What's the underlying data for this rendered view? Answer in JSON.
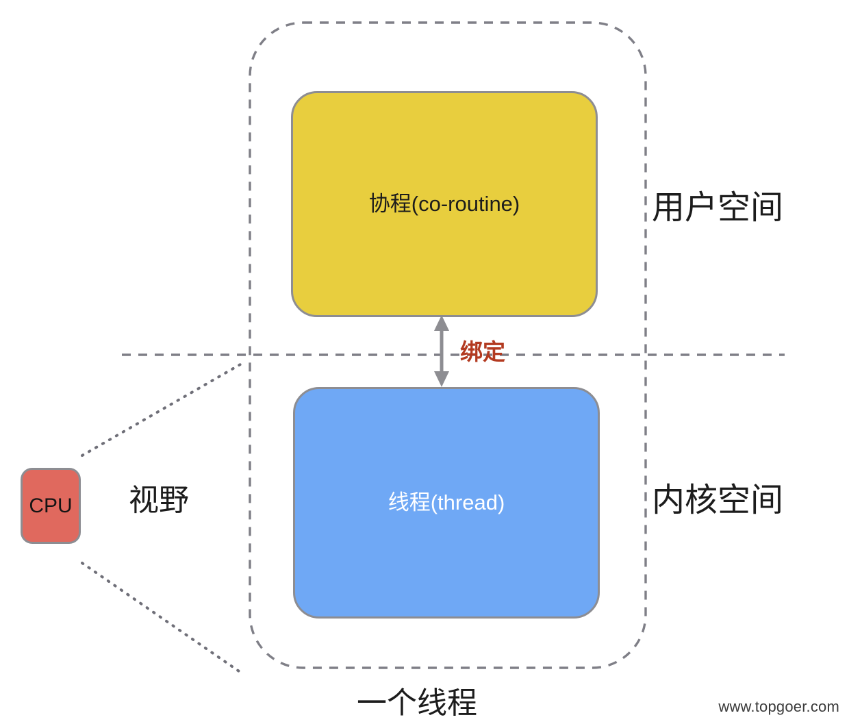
{
  "diagram": {
    "title_bottom": "一个线程",
    "watermark": "www.topgoer.com",
    "colors": {
      "coroutine_fill": "#e8ce3e",
      "thread_fill": "#6fa8f5",
      "cpu_fill": "#e0695e",
      "stroke_gray": "#8d8d92",
      "binding_red": "#b33a20",
      "dash_gray": "#7f7f87"
    },
    "blocks": [
      {
        "id": "coroutine",
        "label": "协程(co-routine)"
      },
      {
        "id": "thread",
        "label": "线程(thread)"
      },
      {
        "id": "cpu",
        "label": "CPU"
      }
    ],
    "regions": {
      "user_space": "用户空间",
      "kernel_space": "内核空间"
    },
    "annotations": {
      "binding": "绑定",
      "view": "视野"
    },
    "icons": {
      "bidirectional_arrow": "bidirectional-arrow-icon",
      "process_boundary": "dashed-rounded-boundary-icon",
      "space_divider": "dashed-divider-icon",
      "view_cone_upper": "dotted-sightline-icon",
      "view_cone_lower": "dotted-sightline-icon"
    }
  }
}
